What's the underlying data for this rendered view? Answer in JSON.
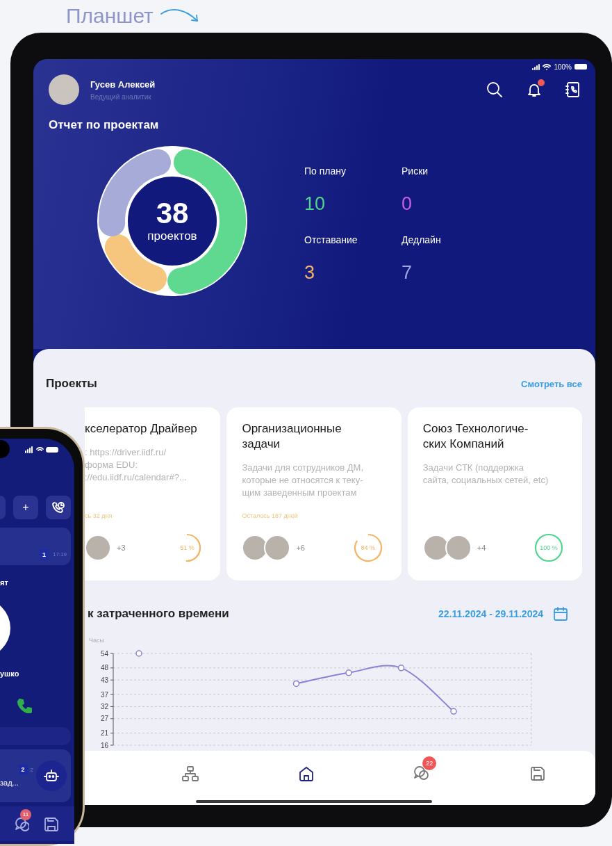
{
  "caption": {
    "label": "Планшет"
  },
  "tablet": {
    "status_bar": {
      "battery": "100%"
    },
    "profile": {
      "name": "Гусев Алексей",
      "role": "Ведущий аналитик"
    },
    "notifications": {
      "unread": true
    },
    "report": {
      "title": "Отчет по проектам",
      "total": "38",
      "total_label": "проектов",
      "stats": [
        {
          "label": "По плану",
          "value": "10",
          "color": "#4fd68d"
        },
        {
          "label": "Риски",
          "value": "0",
          "color": "#c65ee6"
        },
        {
          "label": "Отставание",
          "value": "3",
          "color": "#f4b466"
        },
        {
          "label": "Дедлайн",
          "value": "7",
          "color": "#9da3e3"
        }
      ]
    },
    "projects": {
      "title": "Проекты",
      "link": "Смотреть все",
      "cards": [
        {
          "title": [
            "кселератор Драйвер"
          ],
          "description": [
            ": https://driver.iidf.ru/",
            "форма EDU:",
            "://edu.iidf.ru/calendar#?..."
          ],
          "remaining": "сь 32 дня",
          "avatars": [
            {
              "kind": "photo"
            }
          ],
          "extra_members": "+3",
          "percent": "51 %",
          "level": 0.51,
          "color": "#f4b466"
        },
        {
          "title": [
            "Организационные",
            "задачи"
          ],
          "description": [
            "Задачи для сотрудников ДМ,",
            "которые не относятся к теку-",
            "щим заведенным проектам"
          ],
          "remaining": "Осталось 187 дней",
          "avatars": [
            {
              "kind": "photo"
            },
            {
              "kind": "photo"
            }
          ],
          "extra_members": "+6",
          "percent": "84 %",
          "level": 0.84,
          "color": "#f4b466"
        },
        {
          "title": [
            "Союз Технологиче-",
            "ских Компаний"
          ],
          "description": [
            "Задачи СТК (поддержка",
            "сайта, социальных сетей, etc)"
          ],
          "avatars": [
            {
              "kind": "photo"
            },
            {
              "kind": "photo"
            }
          ],
          "extra_members": "+4",
          "percent": "100 %",
          "level": 1,
          "color": "#4fd68d"
        }
      ]
    },
    "time_chart": {
      "title": "к затраченного времени",
      "date_range": "22.11.2024 - 29.11.2024",
      "chart_data": {
        "type": "line",
        "ylabel": "Часы",
        "ylim": [
          16,
          54
        ],
        "yticks": [
          16,
          21,
          27,
          32,
          37,
          43,
          48,
          54
        ],
        "grid": true,
        "series": [
          {
            "color": "#8b80d6",
            "marker": true,
            "values": [
              54,
              null,
              null,
              41.5,
              46,
              48,
              30,
              null
            ]
          }
        ]
      }
    },
    "nav": [
      {
        "kind": "hierarchy",
        "selected": false
      },
      {
        "kind": "home",
        "selected": true
      },
      {
        "kind": "chat",
        "selected": false,
        "badge": "22"
      },
      {
        "kind": "save",
        "selected": false
      }
    ]
  },
  "phone": {
    "actions": [
      {
        "kind": "partial"
      },
      {
        "kind": "add",
        "label": "+"
      },
      {
        "kind": "call-history"
      }
    ],
    "chat": {
      "count": "1",
      "time": "17:19"
    },
    "contact_fragment": "ят",
    "caller_fragment": "ушко",
    "task": {
      "count": "2",
      "secondary": "2",
      "text": "зад..."
    },
    "nav": [
      {
        "kind": "chat",
        "badge": "11"
      },
      {
        "kind": "save"
      }
    ]
  }
}
